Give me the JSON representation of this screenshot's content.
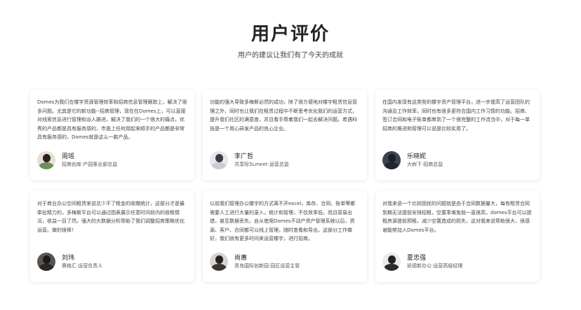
{
  "header": {
    "title": "用户评价",
    "subtitle": "用户的建议让我们有了今天的成就"
  },
  "testimonials": [
    {
      "text": "Domes为我们在楼宇资源管理效率和招商信息管理跟踪上，解决了很多问题。尤其是它的新功能--招商管理，现在在Domes上，可以直接对线索信息进行管理和派人跟进，解决了我们的一个很大的痛点。优秀的产品都是具有服务感的，市面上任何用起来顺手的产品都是非常具有服务感的，Domes就是这么一款产品。",
      "name": "周瑶",
      "role": "招商创库·产园事业部总监",
      "avatar_colors": {
        "bg": "#e8e0d6",
        "head": "#2a2220",
        "body": "#6d8f5a"
      }
    },
    {
      "text": "功能的强大导致多梅斯必然的成功，除了很方便地对楼宇租赁信息管理之外，同时也让我们在租赁过程中不断思考优化我们的运营方式，提升我们社区的满意度，并且看手帮着我们一起去解决问题。希遇科技是一个用心研发产品的良心企业。",
      "name": "李广哲",
      "role": "共享际5Lmeet·运营总监",
      "avatar_colors": {
        "bg": "#e4e7ec",
        "head": "#3a3a40",
        "body": "#c9ccd3"
      }
    },
    {
      "text": "在国内发现有这类型的楼宇资产管理平台，进一步提高了运营团队的沟通及工作效率，同时也有很多更符合国内工作习惯的功能。招商、签订合同和电子账单都串到了一个很完整的工作流当中，对于每一单招商的推进和管理可以说是比较实用了。",
      "name": "乐晓妮",
      "role": "大树下·招商总监",
      "avatar_colors": {
        "bg": "#3c4250",
        "head": "#1e1e24",
        "body": "#23262e"
      }
    },
    {
      "text": "对于商业办公空间租赁来说总少不了租金的收缴统计，这部分才是最牵扯精力的，多梅斯平台可以通过图表展示任意时间段内的收租情况，收益一目了然。强大的大数据分析帮助了我们调整招商策略优化运营。做的很棒！",
      "name": "刘玮",
      "role": "赛格汇·运营负责人",
      "avatar_colors": {
        "bg": "#5a5550",
        "head": "#1c1a18",
        "body": "#2a2826"
      }
    },
    {
      "text": "以前我们管理办公楼宇的方式离不开excel，库存、合同、账单等都需要人工进行大量的录入，统计和管理，不仅效率低，而且容易出错，甚至数据丢失。自从使用Domes不动产资产管理系统以后，资源、客户、合同都可以线上管理，随时查看和导出，这部分工作做好，我们就有更多时间来运营楼宇，进行招商。",
      "name": "尚惠",
      "role": "青岛国际创新园·园区运营主管",
      "avatar_colors": {
        "bg": "#d8d4cf",
        "head": "#25221f",
        "body": "#3b3632"
      }
    },
    {
      "text": "对我来说一个比较困扰的问题就是由于合同数据量大，每有租赁合同到期无法提前安排招租，空置率难免就一直很高，domes平台可以提租房源提前预租，减少空置造成的损失，这对我来说帮助很大，很感谢能够加入Domes平台。",
      "name": "夏忠强",
      "role": "凯德新办公·运营高级经理",
      "avatar_colors": {
        "bg": "#eceae6",
        "head": "#222",
        "body": "#2b2b2e"
      }
    }
  ]
}
